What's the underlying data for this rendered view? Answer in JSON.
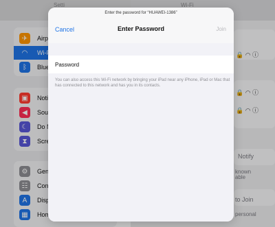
{
  "background": {
    "top_left_label": "Setti",
    "top_right_label": "Wi-Fi"
  },
  "sidebar": {
    "items": [
      {
        "label": "Airpl",
        "icon": "airplane-icon",
        "color": "#ff9500"
      },
      {
        "label": "Wi-F",
        "icon": "wifi-icon",
        "color": "#1f74e6",
        "selected": true
      },
      {
        "label": "Blue",
        "icon": "bluetooth-icon",
        "color": "#1f74e6"
      },
      {
        "label": "Notif",
        "icon": "notification-icon",
        "color": "#ff3b30"
      },
      {
        "label": "Soun",
        "icon": "speaker-icon",
        "color": "#ff2d55"
      },
      {
        "label": "Do N",
        "icon": "moon-icon",
        "color": "#5856d6"
      },
      {
        "label": "Scre",
        "icon": "hourglass-icon",
        "color": "#5856d6"
      },
      {
        "label": "Gen",
        "icon": "gear-icon",
        "color": "#8e8e93"
      },
      {
        "label": "Cont",
        "icon": "switches-icon",
        "color": "#8e8e93"
      },
      {
        "label": "Disp",
        "icon": "text-size-icon",
        "color": "#1f74e6"
      },
      {
        "label": "Hom",
        "icon": "grid-icon",
        "color": "#1f74e6"
      }
    ]
  },
  "right_panel": {
    "notify_label": "Notify",
    "known_text": "known",
    "available_text": "able",
    "join_label": "to Join",
    "personal_text": "personal"
  },
  "modal": {
    "prompt": "Enter the password for “HUAWEI-1386”",
    "cancel_label": "Cancel",
    "title": "Enter Password",
    "join_label": "Join",
    "password_label": "Password",
    "help_text": "You can also access this Wi-Fi network by bringing your iPad near any iPhone, iPad or Mac that has connected to this network and has you in its contacts."
  },
  "colors": {
    "accent": "#1f74e6",
    "toggle_on": "#34c759"
  }
}
